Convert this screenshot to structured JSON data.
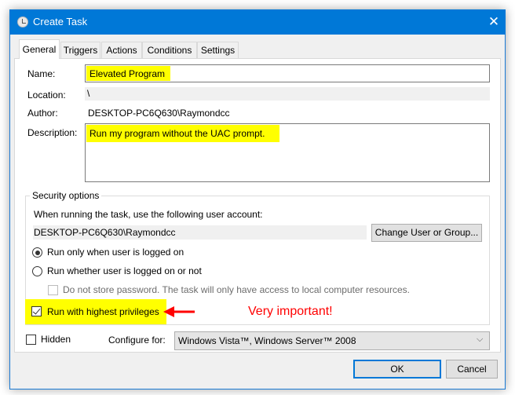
{
  "window": {
    "title": "Create Task",
    "close_icon": "close-icon",
    "app_icon": "clock-icon",
    "accent": "#0078d7"
  },
  "tabs": [
    {
      "label": "General",
      "selected": true
    },
    {
      "label": "Triggers"
    },
    {
      "label": "Actions"
    },
    {
      "label": "Conditions"
    },
    {
      "label": "Settings"
    }
  ],
  "general": {
    "name_label": "Name:",
    "name_value": "Elevated Program",
    "location_label": "Location:",
    "location_value": "\\",
    "author_label": "Author:",
    "author_value": "DESKTOP-PC6Q630\\Raymondcc",
    "description_label": "Description:",
    "description_value": "Run my program without the UAC prompt."
  },
  "security": {
    "legend": "Security options",
    "account_prompt": "When running the task, use the following user account:",
    "account_value": "DESKTOP-PC6Q630\\Raymondcc",
    "change_button": "Change User or Group...",
    "radio_logged_on": "Run only when user is logged on",
    "radio_logged_on_checked": true,
    "radio_whether": "Run whether user is logged on or not",
    "radio_whether_checked": false,
    "no_store_password": "Do not store password.  The task will only have access to local computer resources.",
    "highest_privileges": "Run with highest privileges",
    "highest_privileges_checked": true
  },
  "annotation": {
    "text": "Very important!",
    "color": "#ff0000",
    "highlight": "#ffff00"
  },
  "bottom": {
    "hidden_label": "Hidden",
    "hidden_checked": false,
    "configure_label": "Configure for:",
    "configure_value": "Windows Vista™, Windows Server™ 2008",
    "ok": "OK",
    "cancel": "Cancel"
  }
}
